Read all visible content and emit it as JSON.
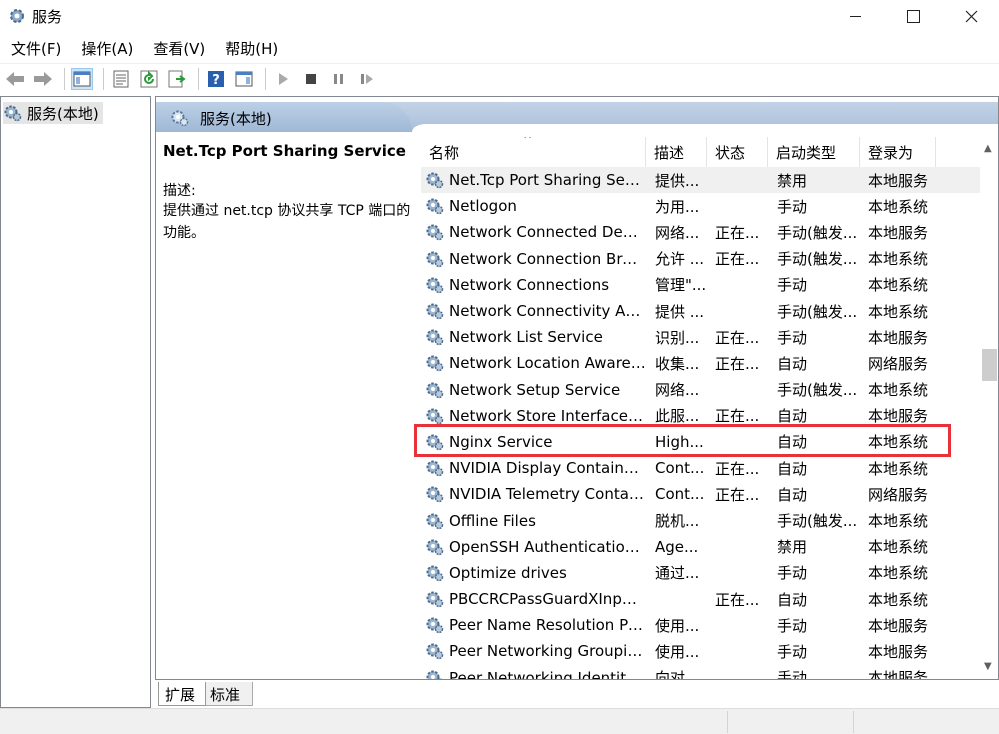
{
  "window": {
    "title": "服务"
  },
  "menu": [
    "文件(F)",
    "操作(A)",
    "查看(V)",
    "帮助(H)"
  ],
  "tree": {
    "root_label": "服务(本地)"
  },
  "pane_header": {
    "title": "服务(本地)"
  },
  "description": {
    "service_name": "Net.Tcp Port Sharing Service",
    "label": "描述:",
    "text": "提供通过 net.tcp 协议共享 TCP 端口的功能。"
  },
  "columns": [
    "名称",
    "描述",
    "状态",
    "启动类型",
    "登录为"
  ],
  "rows": [
    {
      "name": "Net.Tcp Port Sharing Service",
      "desc": "提供...",
      "state": "",
      "start": "禁用",
      "logon": "本地服务"
    },
    {
      "name": "Netlogon",
      "desc": "为用...",
      "state": "",
      "start": "手动",
      "logon": "本地系统"
    },
    {
      "name": "Network Connected Devic...",
      "desc": "网络...",
      "state": "正在...",
      "start": "手动(触发...",
      "logon": "本地服务"
    },
    {
      "name": "Network Connection Broker",
      "desc": "允许 ...",
      "state": "正在...",
      "start": "手动(触发...",
      "logon": "本地系统"
    },
    {
      "name": "Network Connections",
      "desc": "管理\"...",
      "state": "",
      "start": "手动",
      "logon": "本地系统"
    },
    {
      "name": "Network Connectivity Assis...",
      "desc": "提供 ...",
      "state": "",
      "start": "手动(触发...",
      "logon": "本地系统"
    },
    {
      "name": "Network List Service",
      "desc": "识别...",
      "state": "正在...",
      "start": "手动",
      "logon": "本地服务"
    },
    {
      "name": "Network Location Awarene...",
      "desc": "收集...",
      "state": "正在...",
      "start": "自动",
      "logon": "网络服务"
    },
    {
      "name": "Network Setup Service",
      "desc": "网络...",
      "state": "",
      "start": "手动(触发...",
      "logon": "本地系统"
    },
    {
      "name": "Network Store Interface Se...",
      "desc": "此服...",
      "state": "正在...",
      "start": "自动",
      "logon": "本地服务"
    },
    {
      "name": "Nginx Service",
      "desc": "High...",
      "state": "",
      "start": "自动",
      "logon": "本地系统"
    },
    {
      "name": "NVIDIA Display Container LS",
      "desc": "Cont...",
      "state": "正在...",
      "start": "自动",
      "logon": "本地系统"
    },
    {
      "name": "NVIDIA Telemetry Container",
      "desc": "Cont...",
      "state": "正在...",
      "start": "自动",
      "logon": "网络服务"
    },
    {
      "name": "Offline Files",
      "desc": "脱机...",
      "state": "",
      "start": "手动(触发...",
      "logon": "本地系统"
    },
    {
      "name": "OpenSSH Authentication ...",
      "desc": "Age...",
      "state": "",
      "start": "禁用",
      "logon": "本地系统"
    },
    {
      "name": "Optimize drives",
      "desc": "通过...",
      "state": "",
      "start": "手动",
      "logon": "本地系统"
    },
    {
      "name": "PBCCRCPassGuardXInputS...",
      "desc": "",
      "state": "正在...",
      "start": "自动",
      "logon": "本地系统"
    },
    {
      "name": "Peer Name Resolution Pro...",
      "desc": "使用...",
      "state": "",
      "start": "手动",
      "logon": "本地服务"
    },
    {
      "name": "Peer Networking Grouping",
      "desc": "使用...",
      "state": "",
      "start": "手动",
      "logon": "本地服务"
    },
    {
      "name": "Peer Networking Identity ...",
      "desc": "向对...",
      "state": "",
      "start": "手动",
      "logon": "本地服务"
    }
  ],
  "tabs": [
    "扩展",
    "标准"
  ],
  "colors": {
    "highlight": "#e8323a",
    "header_bg": "#a9bfd9",
    "selection": "#cce4f7"
  }
}
